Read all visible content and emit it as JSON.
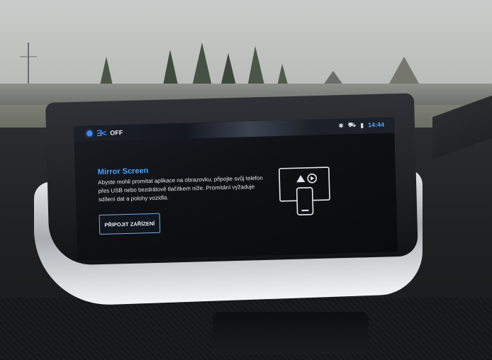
{
  "status_bar": {
    "climate_state": "OFF",
    "time": "14:44",
    "icons": [
      "light-beam-icon",
      "bluetooth-icon",
      "car-icon",
      "signal-icon"
    ]
  },
  "mirror_screen": {
    "title": "Mirror Screen",
    "description": "Abyste mohli promítat aplikace na obrazovku, připojte svůj telefon přes USB nebo bezdrátově tlačítkem níže. Promítání vyžaduje sdílení dat a polohy vozidla.",
    "connect_button_label": "PŘIPOJIT ZAŘÍZENÍ"
  },
  "colors": {
    "accent": "#4da0ff",
    "screen_bg": "#0e1014",
    "text": "#e4e8ee"
  }
}
